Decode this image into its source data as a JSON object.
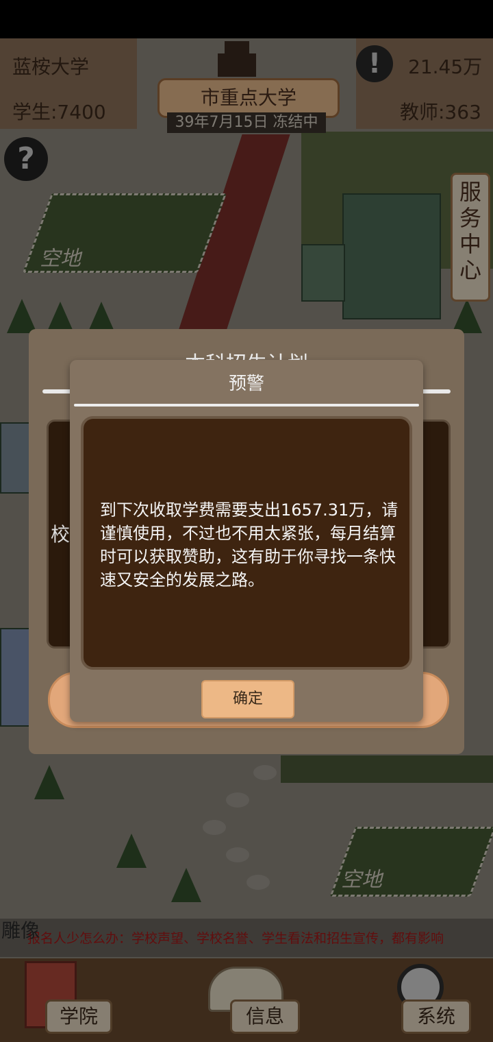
{
  "hud": {
    "school_name": "蓝桉大学",
    "students": "学生:7400",
    "rank": "市重点大学",
    "date_status": "39年7月15日 冻结中",
    "money": "21.45万",
    "teachers": "教师:363",
    "help": "?",
    "alert": "!"
  },
  "map": {
    "lot_label": "空地",
    "statue_label": "雕像"
  },
  "service_center": "服务中心",
  "back_dialog": {
    "title": "本科招生计划",
    "side_text": "校"
  },
  "warning_dialog": {
    "title": "预警",
    "message": "到下次收取学费需要支出1657.31万，请谨慎使用，不过也不用太紧张，每月结算时可以获取赞助，这有助于你寻找一条快速又安全的发展之路。",
    "confirm": "确定"
  },
  "ticker": "报名人少怎么办：学校声望、学校名誉、学生看法和招生宣传，都有影响",
  "bottom_nav": [
    {
      "label": "学院",
      "icon": "building-icon"
    },
    {
      "label": "信息",
      "icon": "book-icon"
    },
    {
      "label": "系统",
      "icon": "magnifier-icon"
    }
  ]
}
